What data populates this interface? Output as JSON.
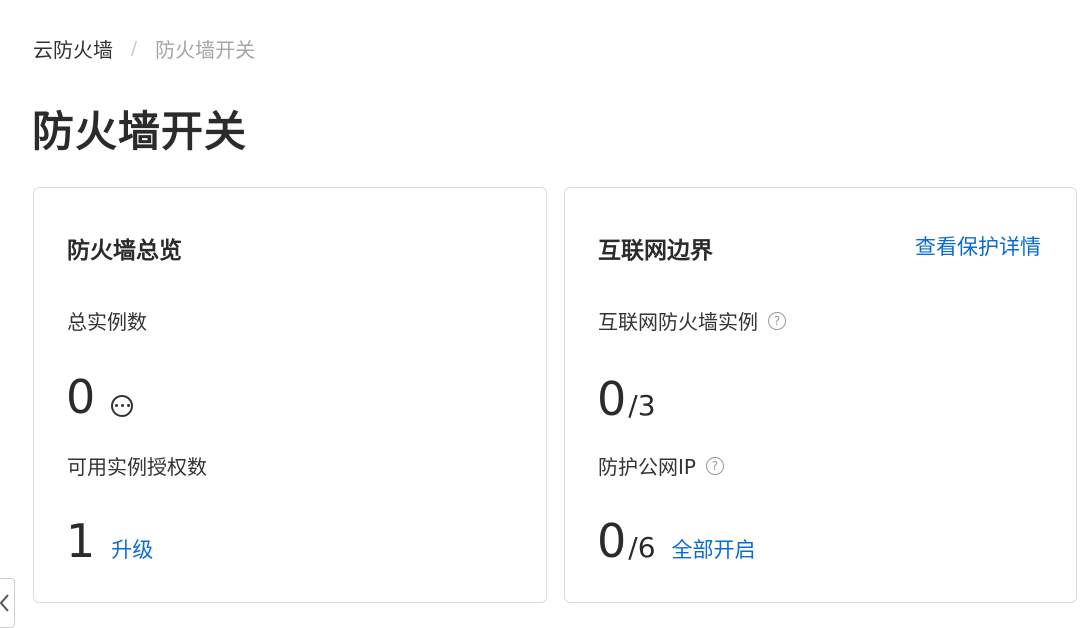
{
  "breadcrumb": {
    "items": [
      "云防火墙",
      "防火墙开关"
    ],
    "separator": "/"
  },
  "page_title": "防火墙开关",
  "overview_card": {
    "title": "防火墙总览",
    "total_instances_label": "总实例数",
    "total_instances_value": "0",
    "more_icon": "ellipsis-circle-icon",
    "available_licenses_label": "可用实例授权数",
    "available_licenses_value": "1",
    "upgrade_link": "升级"
  },
  "internet_card": {
    "title": "互联网边界",
    "view_details_link": "查看保护详情",
    "instances_label": "互联网防火墙实例",
    "instances_value": "0",
    "instances_total": "/3",
    "protected_ip_label": "防护公网IP",
    "protected_ip_value": "0",
    "protected_ip_total": "/6",
    "enable_all_link": "全部开启",
    "help_icon_glyph": "?"
  },
  "colors": {
    "link": "#0a6ccf",
    "text": "#333333",
    "muted": "#a6a6a6",
    "border": "#dcdcdc"
  }
}
